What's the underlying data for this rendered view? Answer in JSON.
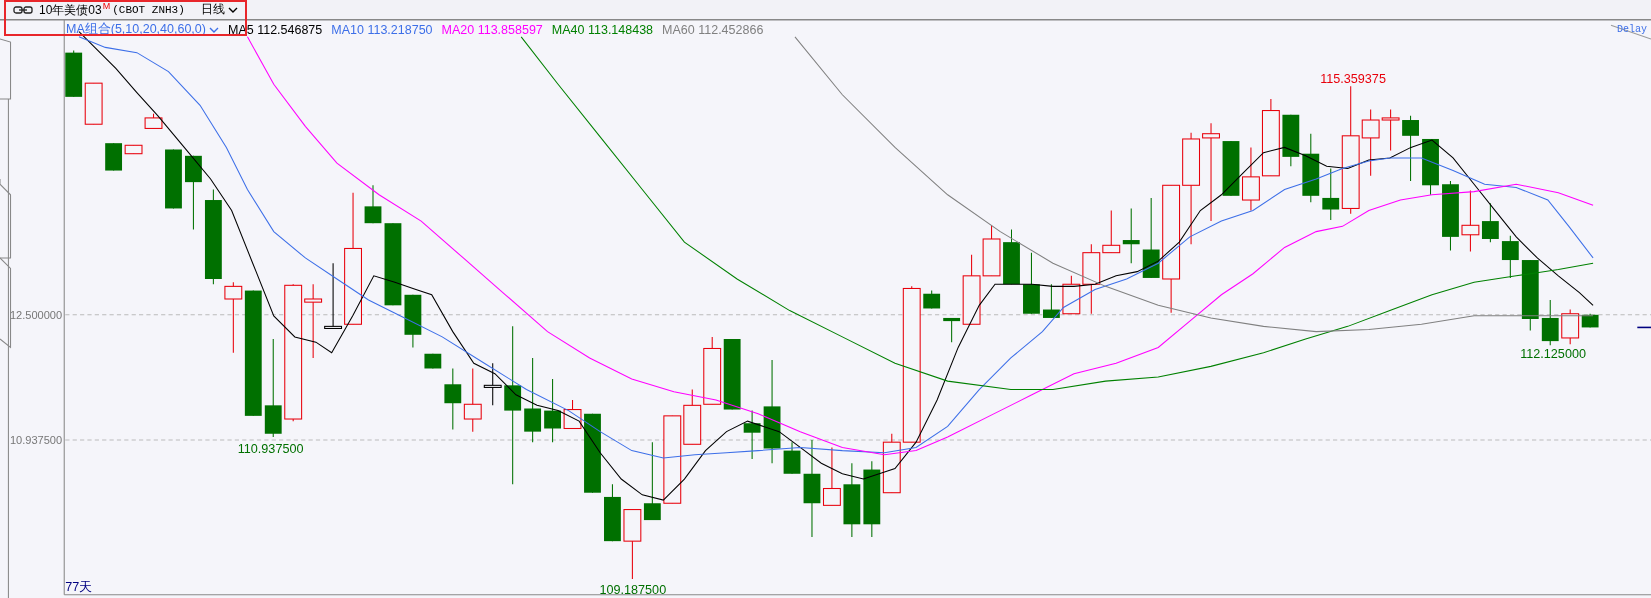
{
  "header": {
    "title": "10年美债03",
    "badge": "M",
    "code": "(CBOT ZNH3)",
    "period": "日线"
  },
  "legend": {
    "selector": "MA组合(5,10,20,40,60,0)",
    "items": [
      {
        "label": "MA5",
        "value": "112.546875",
        "color": "#000000"
      },
      {
        "label": "MA10",
        "value": "113.218750",
        "color": "#3d6fe8"
      },
      {
        "label": "MA20",
        "value": "113.858597",
        "color": "#ff00ff"
      },
      {
        "label": "MA40",
        "value": "113.148438",
        "color": "#008000"
      },
      {
        "label": "MA60",
        "value": "112.452866",
        "color": "#808080"
      }
    ]
  },
  "delay": "Delay",
  "y_axis": [
    "12.500000",
    "10.937500"
  ],
  "annotations": {
    "high": "115.359375",
    "right_low": "112.125000",
    "left_low": "110.937500",
    "low": "109.187500"
  },
  "day_count": "77天"
}
